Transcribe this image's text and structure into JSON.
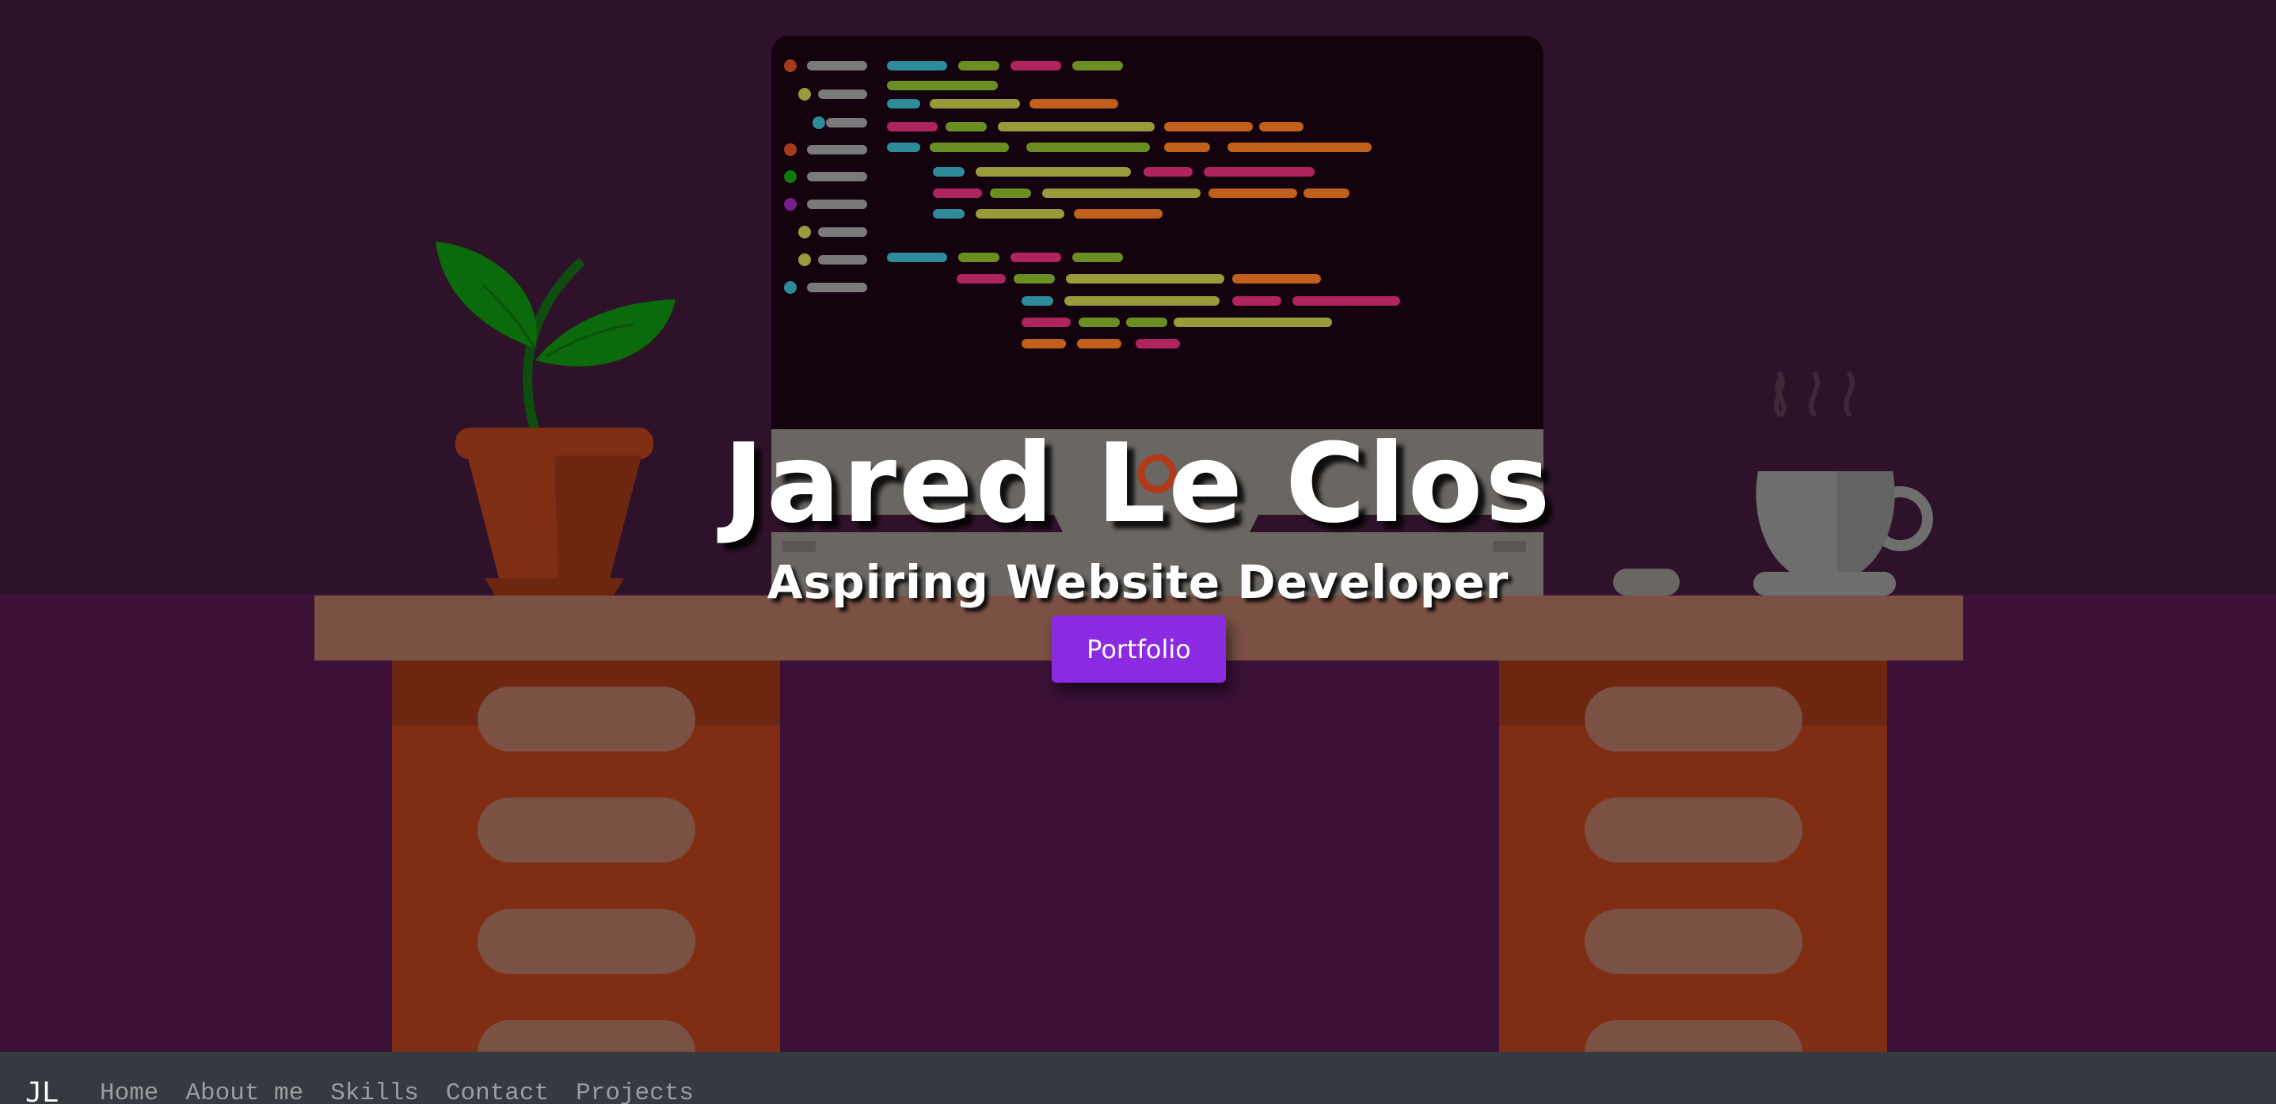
{
  "hero": {
    "title": "Jared Le Clos",
    "subtitle": "Aspiring Website Developer",
    "button_label": "Portfolio"
  },
  "navbar": {
    "brand": "JL",
    "links": [
      "Home",
      "About me",
      "Skills",
      "Contact",
      "Projects"
    ]
  },
  "colors": {
    "wall": "#2e1229",
    "floor": "#3b1137",
    "desk_top": "#7b5144",
    "drawer": "#7f2e14",
    "button": "#8a2be2",
    "navbar": "#343a40"
  },
  "icons": [
    "plant-illustration",
    "monitor-illustration",
    "coffee-mug-illustration",
    "mouse-illustration",
    "ubuntu-logo-icon"
  ]
}
